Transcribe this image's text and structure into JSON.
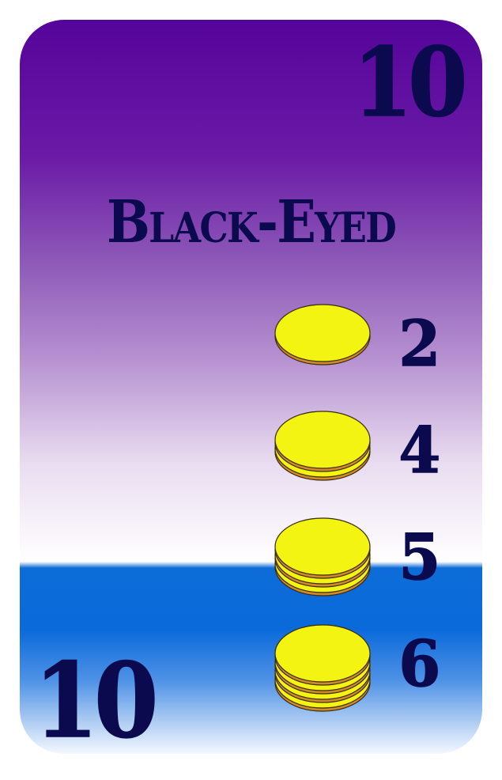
{
  "card": {
    "rank": "10",
    "title": "Black-Eyed",
    "coin_color": "#f4f412",
    "coin_edge_color": "#cf8a2a",
    "ink_color": "#0c0a4e",
    "rows": [
      {
        "value": "2",
        "coins": 1
      },
      {
        "value": "4",
        "coins": 2
      },
      {
        "value": "5",
        "coins": 3
      },
      {
        "value": "6",
        "coins": 4
      }
    ]
  }
}
